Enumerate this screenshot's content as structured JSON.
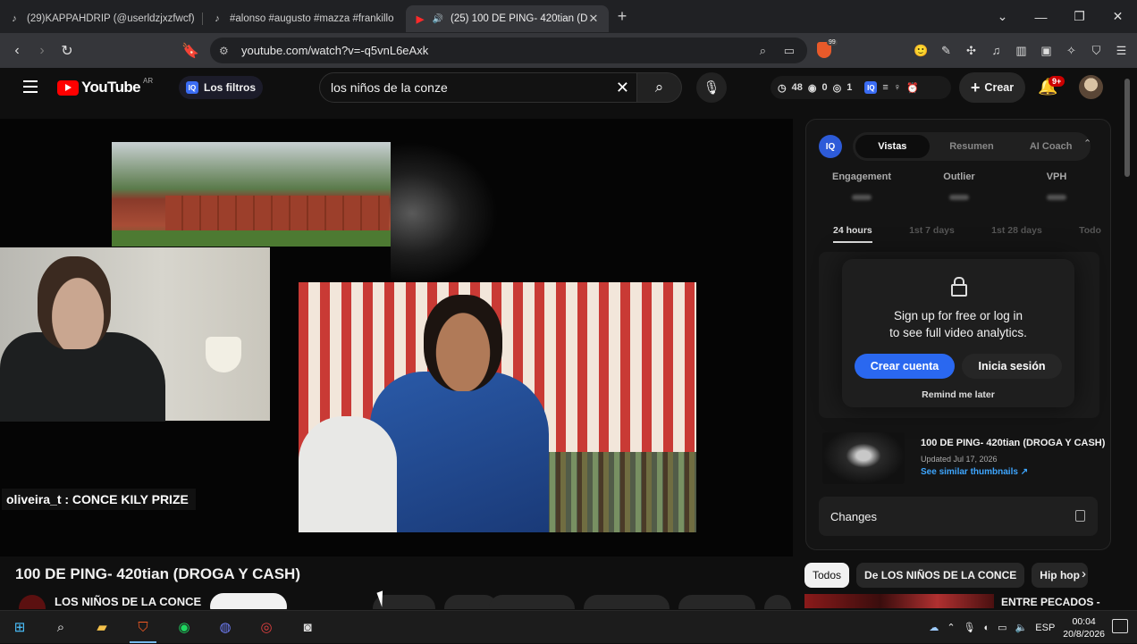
{
  "browser": {
    "tabs": [
      {
        "label": "(29)KAPPAHDRIP (@userldzjxzfwcf) |",
        "icon": "tiktok-icon"
      },
      {
        "label": "#alonso #augusto #mazza #frankillo",
        "icon": "tiktok-icon"
      },
      {
        "label": "(25) 100 DE PING- 420tian (D",
        "icon": "youtube-icon",
        "active": true
      }
    ],
    "new_tab": "+",
    "url": "youtube.com/watch?v=-q5vnL6eAxk",
    "shield_badge": "99"
  },
  "youtube": {
    "logo_text": "YouTube",
    "country": "AR",
    "filters_label": "Los filtros",
    "search_value": "los niños de la conze",
    "stats": {
      "time": "48",
      "eye1": "0",
      "eye2": "1"
    },
    "create_label": "Crear",
    "notif_badge": "9+"
  },
  "video": {
    "chat_overlay": "oliveira_t : CONCE KILY PRIZE",
    "title": "100 DE PING- 420tian (DROGA Y CASH)",
    "channel": "LOS NIÑOS DE LA CONCE"
  },
  "panel": {
    "tabs": [
      "Vistas",
      "Resumen",
      "AI Coach"
    ],
    "active_tab": "Vistas",
    "metrics": [
      "Engagement",
      "Outlier",
      "VPH"
    ],
    "periods": [
      "24 hours",
      "1st 7 days",
      "1st 28 days",
      "Todo"
    ],
    "lock_line1": "Sign up for free or log in",
    "lock_line2": "to see full video analytics.",
    "btn_create": "Crear cuenta",
    "btn_login": "Inicia sesión",
    "remind": "Remind me later",
    "video_title": "100 DE PING- 420tian (DROGA Y CASH)",
    "video_updated": "Updated Jul 17, 2026",
    "similar_link": "See similar thumbnails ↗",
    "changes": "Changes"
  },
  "chips": [
    "Todos",
    "De LOS NIÑOS DE LA CONCE",
    "Hip hop"
  ],
  "related": {
    "title": "ENTRE PECADOS -"
  },
  "taskbar": {
    "lang": "ESP",
    "time": "00:04",
    "date": "20/8/2026"
  }
}
